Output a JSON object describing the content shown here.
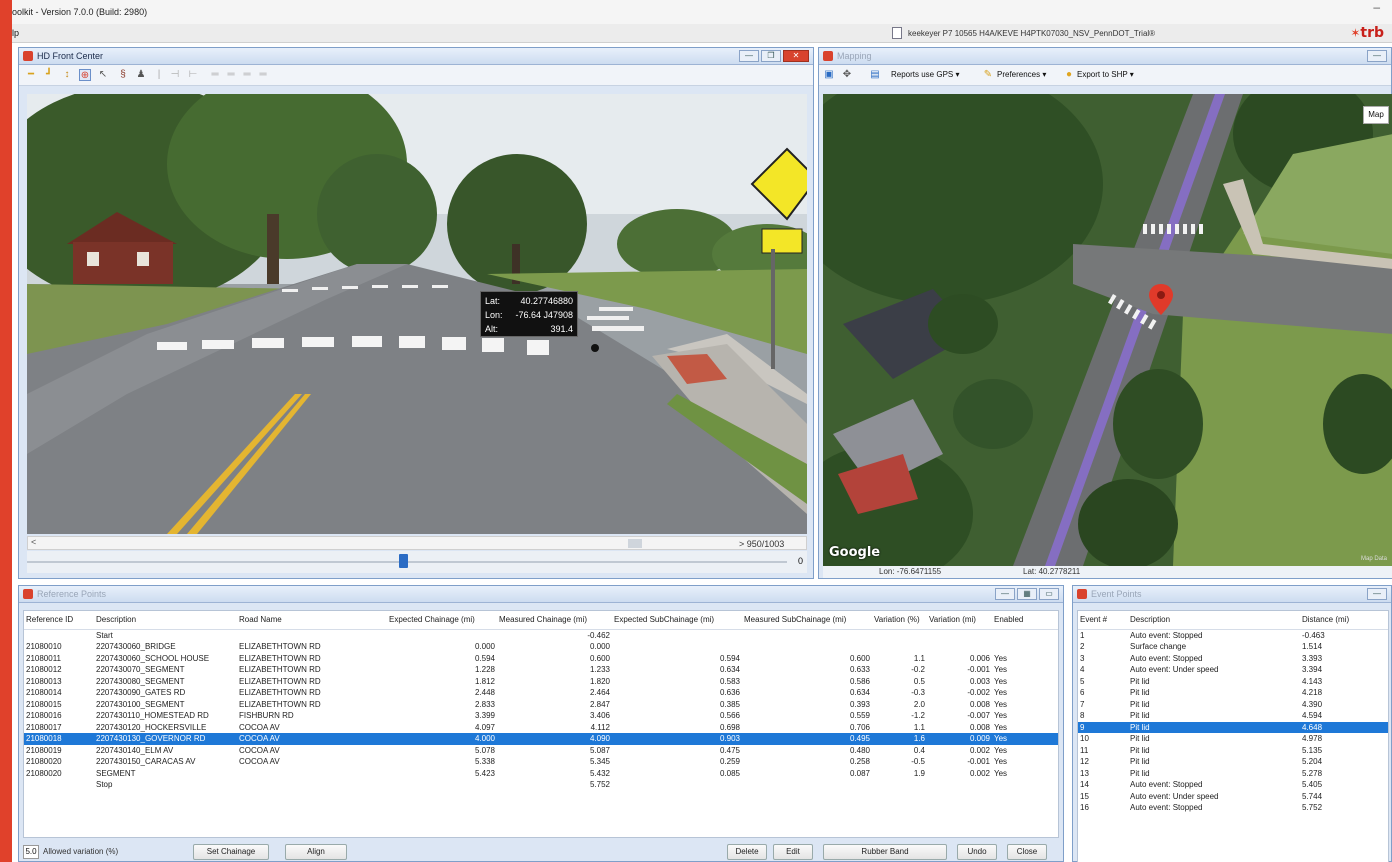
{
  "app": {
    "title": "oolkit - Version 7.0.0 (Build: 2980)",
    "menu_fragment": "lp",
    "license": "keekeyer P7 10565 H4A/KEVE H4PTK07030_NSV_PennDOT_Trial®",
    "logo": "trb",
    "minimize_glyph": "–"
  },
  "video_pane": {
    "title": "HD Front Center",
    "coord_popup": {
      "lat_label": "Lat:",
      "lat": "40.27746880",
      "lon_label": "Lon:",
      "lon": "-76.64 J47908",
      "alt_label": "Alt:",
      "alt": "391.4"
    },
    "frame_counter": "> 950/1003",
    "frame_pos": "0",
    "scroll_left": "<"
  },
  "mapping_pane": {
    "title": "Mapping",
    "toolbar": {
      "reports": "Reports use GPS ▾",
      "preferences": "Preferences ▾",
      "export": "Export to SHP ▾"
    },
    "map_type": "Map",
    "watermark": "Google",
    "map_data": "Map Data",
    "lon_readout": "Lon: -76.6471155",
    "lat_readout": "Lat: 40.2778211"
  },
  "reference_points": {
    "title": "Reference Points",
    "columns": [
      "Reference ID",
      "Description",
      "Road Name",
      "Expected Chainage (mi)",
      "Measured Chainage (mi)",
      "Expected SubChainage (mi)",
      "Measured SubChainage (mi)",
      "Variation (%)",
      "Variation (mi)",
      "Enabled"
    ],
    "rows": [
      [
        "",
        "Start",
        "",
        "",
        "-0.462",
        "",
        "",
        "",
        "",
        ""
      ],
      [
        "21080010",
        "2207430060_BRIDGE",
        "ELIZABETHTOWN RD",
        "0.000",
        "0.000",
        "",
        "",
        "",
        "",
        ""
      ],
      [
        "21080011",
        "2207430060_SCHOOL HOUSE",
        "ELIZABETHTOWN RD",
        "0.594",
        "0.600",
        "0.594",
        "0.600",
        "1.1",
        "0.006",
        "Yes"
      ],
      [
        "21080012",
        "2207430070_SEGMENT",
        "ELIZABETHTOWN RD",
        "1.228",
        "1.233",
        "0.634",
        "0.633",
        "-0.2",
        "-0.001",
        "Yes"
      ],
      [
        "21080013",
        "2207430080_SEGMENT",
        "ELIZABETHTOWN RD",
        "1.812",
        "1.820",
        "0.583",
        "0.586",
        "0.5",
        "0.003",
        "Yes"
      ],
      [
        "21080014",
        "2207430090_GATES RD",
        "ELIZABETHTOWN RD",
        "2.448",
        "2.464",
        "0.636",
        "0.634",
        "-0.3",
        "-0.002",
        "Yes"
      ],
      [
        "21080015",
        "2207430100_SEGMENT",
        "ELIZABETHTOWN RD",
        "2.833",
        "2.847",
        "0.385",
        "0.393",
        "2.0",
        "0.008",
        "Yes"
      ],
      [
        "21080016",
        "2207430110_HOMESTEAD RD",
        "FISHBURN RD",
        "3.399",
        "3.406",
        "0.566",
        "0.559",
        "-1.2",
        "-0.007",
        "Yes"
      ],
      [
        "21080017",
        "2207430120_HOCKERSVILLE",
        "COCOA AV",
        "4.097",
        "4.112",
        "0.698",
        "0.706",
        "1.1",
        "0.008",
        "Yes"
      ],
      [
        "21080018",
        "2207430130_GOVERNOR RD",
        "COCOA AV",
        "4.000",
        "4.090",
        "0.903",
        "0.495",
        "1.6",
        "0.009",
        "Yes"
      ],
      [
        "21080019",
        "2207430140_ELM AV",
        "COCOA AV",
        "5.078",
        "5.087",
        "0.475",
        "0.480",
        "0.4",
        "0.002",
        "Yes"
      ],
      [
        "21080020",
        "2207430150_CARACAS AV",
        "COCOA AV",
        "5.338",
        "5.345",
        "0.259",
        "0.258",
        "-0.5",
        "-0.001",
        "Yes"
      ],
      [
        "21080020",
        "SEGMENT",
        "",
        "5.423",
        "5.432",
        "0.085",
        "0.087",
        "1.9",
        "0.002",
        "Yes"
      ],
      [
        "",
        "Stop",
        "",
        "",
        "5.752",
        "",
        "",
        "",
        "",
        ""
      ]
    ],
    "selected_row": 9,
    "allowed_value": "5.0",
    "allowed_label": "Allowed variation (%)",
    "buttons": {
      "set_chainage": "Set Chainage",
      "align": "Align",
      "delete": "Delete",
      "edit": "Edit",
      "rubber": "Rubber Band",
      "undo": "Undo",
      "close": "Close"
    }
  },
  "event_points": {
    "title": "Event Points",
    "columns": [
      "Event #",
      "Description",
      "Distance (mi)"
    ],
    "rows": [
      [
        "1",
        "Auto event: Stopped",
        "-0.463"
      ],
      [
        "2",
        "Surface change",
        "1.514"
      ],
      [
        "3",
        "Auto event: Stopped",
        "3.393"
      ],
      [
        "4",
        "Auto event: Under speed",
        "3.394"
      ],
      [
        "5",
        "Pit lid",
        "4.143"
      ],
      [
        "6",
        "Pit lid",
        "4.218"
      ],
      [
        "7",
        "Pit lid",
        "4.390"
      ],
      [
        "8",
        "Pit lid",
        "4.594"
      ],
      [
        "9",
        "Pit lid",
        "4.648"
      ],
      [
        "10",
        "Pit lid",
        "4.978"
      ],
      [
        "11",
        "Pit lid",
        "5.135"
      ],
      [
        "12",
        "Pit lid",
        "5.204"
      ],
      [
        "13",
        "Pit lid",
        "5.278"
      ],
      [
        "14",
        "Auto event: Stopped",
        "5.405"
      ],
      [
        "15",
        "Auto event: Under speed",
        "5.744"
      ],
      [
        "16",
        "Auto event: Stopped",
        "5.752"
      ]
    ],
    "selected_row": 8
  },
  "colors": {
    "accent": "#e0412b",
    "selection": "#1e78d7",
    "pane": "#dce6f4"
  }
}
